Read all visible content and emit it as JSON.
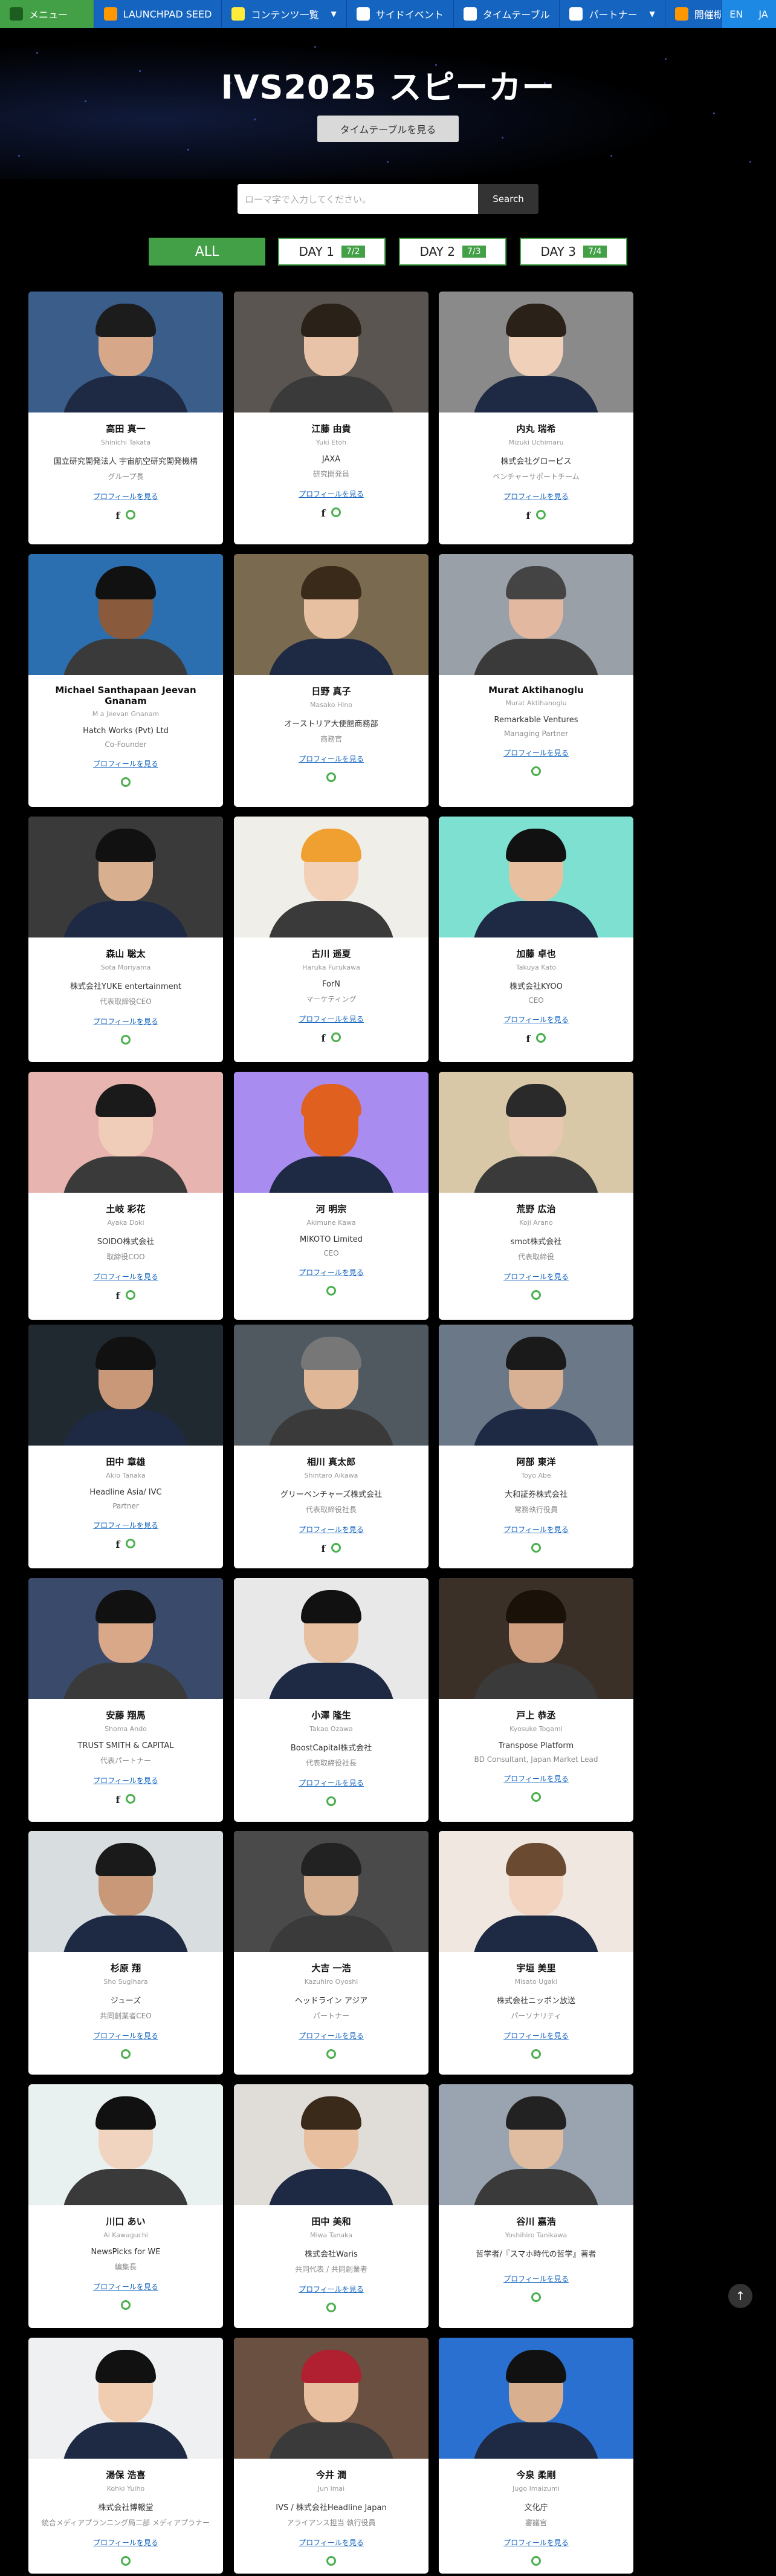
{
  "nav": {
    "items": [
      {
        "label": "メニュー",
        "caret": "–"
      },
      {
        "label": "LAUNCHPAD SEED"
      },
      {
        "label": "コンテンツ一覧",
        "caret": "▼"
      },
      {
        "label": "サイドイベント"
      },
      {
        "label": "タイムテーブル"
      },
      {
        "label": "パートナー",
        "caret": "▼"
      },
      {
        "label": "開催概要"
      }
    ],
    "lang_en": "EN",
    "lang_ja": "JA"
  },
  "hero": {
    "title": "IVS2025 スピーカー",
    "timetable_button": "タイムテーブルを見る"
  },
  "search": {
    "placeholder": "ローマ字で入力してください。",
    "button": "Search"
  },
  "filters": {
    "all": "ALL",
    "day1": "DAY 1",
    "day1_count": "7/2",
    "day2": "DAY 2",
    "day2_count": "7/3",
    "day3": "DAY 3",
    "day3_count": "7/4"
  },
  "profile_link": "プロフィールを見る",
  "speakers": [
    {
      "name": "高田 真一",
      "roman": "Shinichi Takata",
      "org": "国立研究開発法人 宇宙航空研究開発機構",
      "role": "グループ長",
      "fb": true
    },
    {
      "name": "江藤 由貴",
      "roman": "Yuki Etoh",
      "org": "JAXA",
      "role": "研究開発員",
      "fb": true
    },
    {
      "name": "内丸 瑞希",
      "roman": "Mizuki Uchimaru",
      "org": "株式会社グローピス",
      "role": "ベンチャーサポートチーム",
      "fb": true
    },
    {
      "name": "Michael Santhapaan Jeevan Gnanam",
      "roman": "M a Jeevan Gnanam",
      "org": "Hatch Works (Pvt) Ltd",
      "role": "Co-Founder",
      "fb": false
    },
    {
      "name": "日野 真子",
      "roman": "Masako Hino",
      "org": "オーストリア大使館商務部",
      "role": "商務官",
      "fb": false
    },
    {
      "name": "Murat Aktihanoglu",
      "roman": "Murat Aktihanoglu",
      "org": "Remarkable Ventures",
      "role": "Managing Partner",
      "fb": false
    },
    {
      "name": "森山 聡太",
      "roman": "Sota Moriyama",
      "org": "株式会社YUKE entertainment",
      "role": "代表取締役CEO",
      "fb": false
    },
    {
      "name": "古川 遥夏",
      "roman": "Haruka Furukawa",
      "org": "ForN",
      "role": "マーケティング",
      "fb": true
    },
    {
      "name": "加藤 卓也",
      "roman": "Takuya Kato",
      "org": "株式会社KYOO",
      "role": "CEO",
      "fb": true
    },
    {
      "name": "土岐 彩花",
      "roman": "Ayaka Doki",
      "org": "SOIDO株式会社",
      "role": "取締役COO",
      "fb": true
    },
    {
      "name": "河 明宗",
      "roman": "Akimune Kawa",
      "org": "MIKOTO Limited",
      "role": "CEO",
      "fb": false
    },
    {
      "name": "荒野 広治",
      "roman": "Koji Arano",
      "org": "smot株式会社",
      "role": "代表取締役",
      "fb": false
    },
    {
      "name": "田中 章雄",
      "roman": "Akio Tanaka",
      "org": "Headline Asia/ IVC",
      "role": "Partner",
      "fb": true
    },
    {
      "name": "相川 真太郎",
      "roman": "Shintaro Aikawa",
      "org": "グリーベンチャーズ株式会社",
      "role": "代表取締役社長",
      "fb": true
    },
    {
      "name": "阿部 東洋",
      "roman": "Toyo Abe",
      "org": "大和証券株式会社",
      "role": "常務執行役員",
      "fb": false
    },
    {
      "name": "安藤 翔馬",
      "roman": "Shoma Ando",
      "org": "TRUST SMITH & CAPITAL",
      "role": "代表パートナー",
      "fb": true
    },
    {
      "name": "小澤 隆生",
      "roman": "Takao Ozawa",
      "org": "BoostCapital株式会社",
      "role": "代表取締役社長",
      "fb": false
    },
    {
      "name": "戸上 恭丞",
      "roman": "Kyosuke Togami",
      "org": "Transpose Platform",
      "role": "BD Consultant, Japan Market Lead",
      "fb": false
    },
    {
      "name": "杉原 翔",
      "roman": "Sho Sugihara",
      "org": "ジューズ",
      "role": "共同創業者CEO",
      "fb": false
    },
    {
      "name": "大吉 一浩",
      "roman": "Kazuhiro Oyoshi",
      "org": "ヘッドライン アジア",
      "role": "パートナー",
      "fb": false
    },
    {
      "name": "宇垣 美里",
      "roman": "Misato Ugaki",
      "org": "株式会社ニッポン放送",
      "role": "パーソナリティ",
      "fb": false
    },
    {
      "name": "川口 あい",
      "roman": "Ai Kawaguchi",
      "org": "NewsPicks for WE",
      "role": "編集長",
      "fb": false
    },
    {
      "name": "田中 美和",
      "roman": "Miwa Tanaka",
      "org": "株式会社Waris",
      "role": "共同代表 / 共同創業者",
      "fb": false
    },
    {
      "name": "谷川 嘉浩",
      "roman": "Yoshihiro Tanikawa",
      "org": "哲学者/『スマホ時代の哲学』著者",
      "role": "",
      "fb": false
    },
    {
      "name": "湯保 浩喜",
      "roman": "Kohki Yuiho",
      "org": "株式会社博報堂",
      "role": "統合メディアプランニング局二部 メディアプラナー",
      "fb": false
    },
    {
      "name": "今井 潤",
      "roman": "Jun Imai",
      "org": "IVS / 株式会社Headline Japan",
      "role": "アライアンス担当 執行役員",
      "fb": false
    },
    {
      "name": "今泉 柔剛",
      "roman": "Jugo Imaizumi",
      "org": "文化庁",
      "role": "審議官",
      "fb": false
    }
  ],
  "colors": {
    "nav": "#1565c0",
    "menu": "#43a047",
    "accent_green": "#43a047",
    "link": "#1565c0",
    "background": "#000000"
  }
}
